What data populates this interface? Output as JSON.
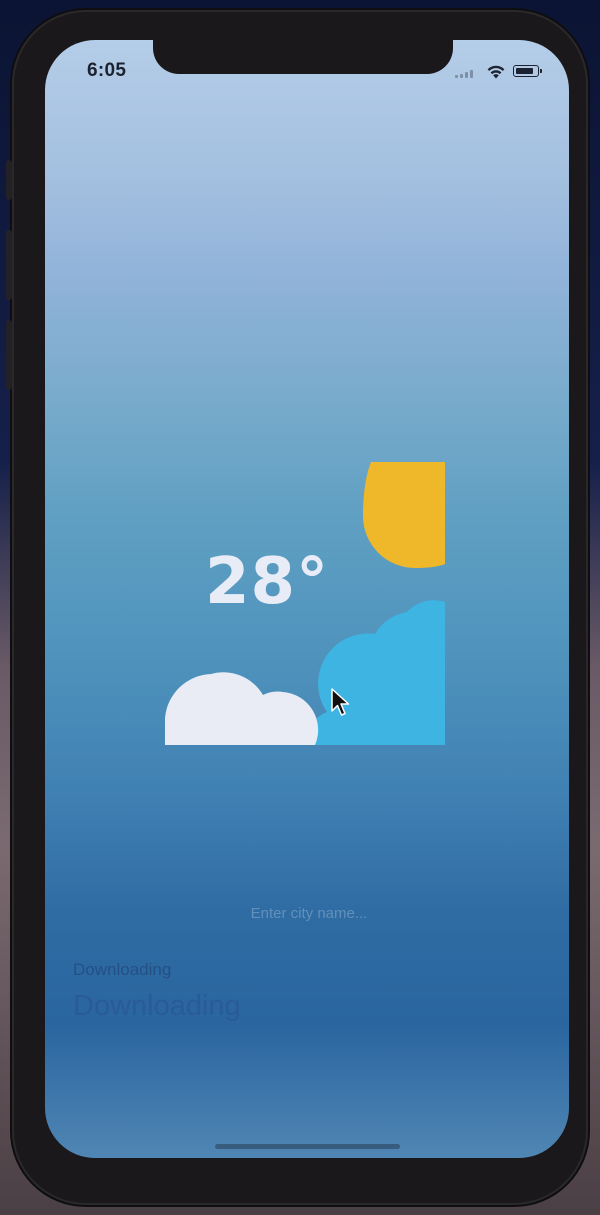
{
  "status_bar": {
    "time": "6:05",
    "battery_level": 0.85
  },
  "weather": {
    "temperature": "28°",
    "sun_color": "#EFB82A",
    "cloud_front_color": "#E9ECF5",
    "cloud_back_color": "#3EB4E2"
  },
  "city_input": {
    "placeholder": "Enter city name..."
  },
  "status": {
    "small_label": "Downloading",
    "large_label": "Downloading"
  },
  "icons": {
    "wifi": "wifi-icon",
    "battery": "battery-icon",
    "cursor": "mouse-pointer-icon"
  }
}
